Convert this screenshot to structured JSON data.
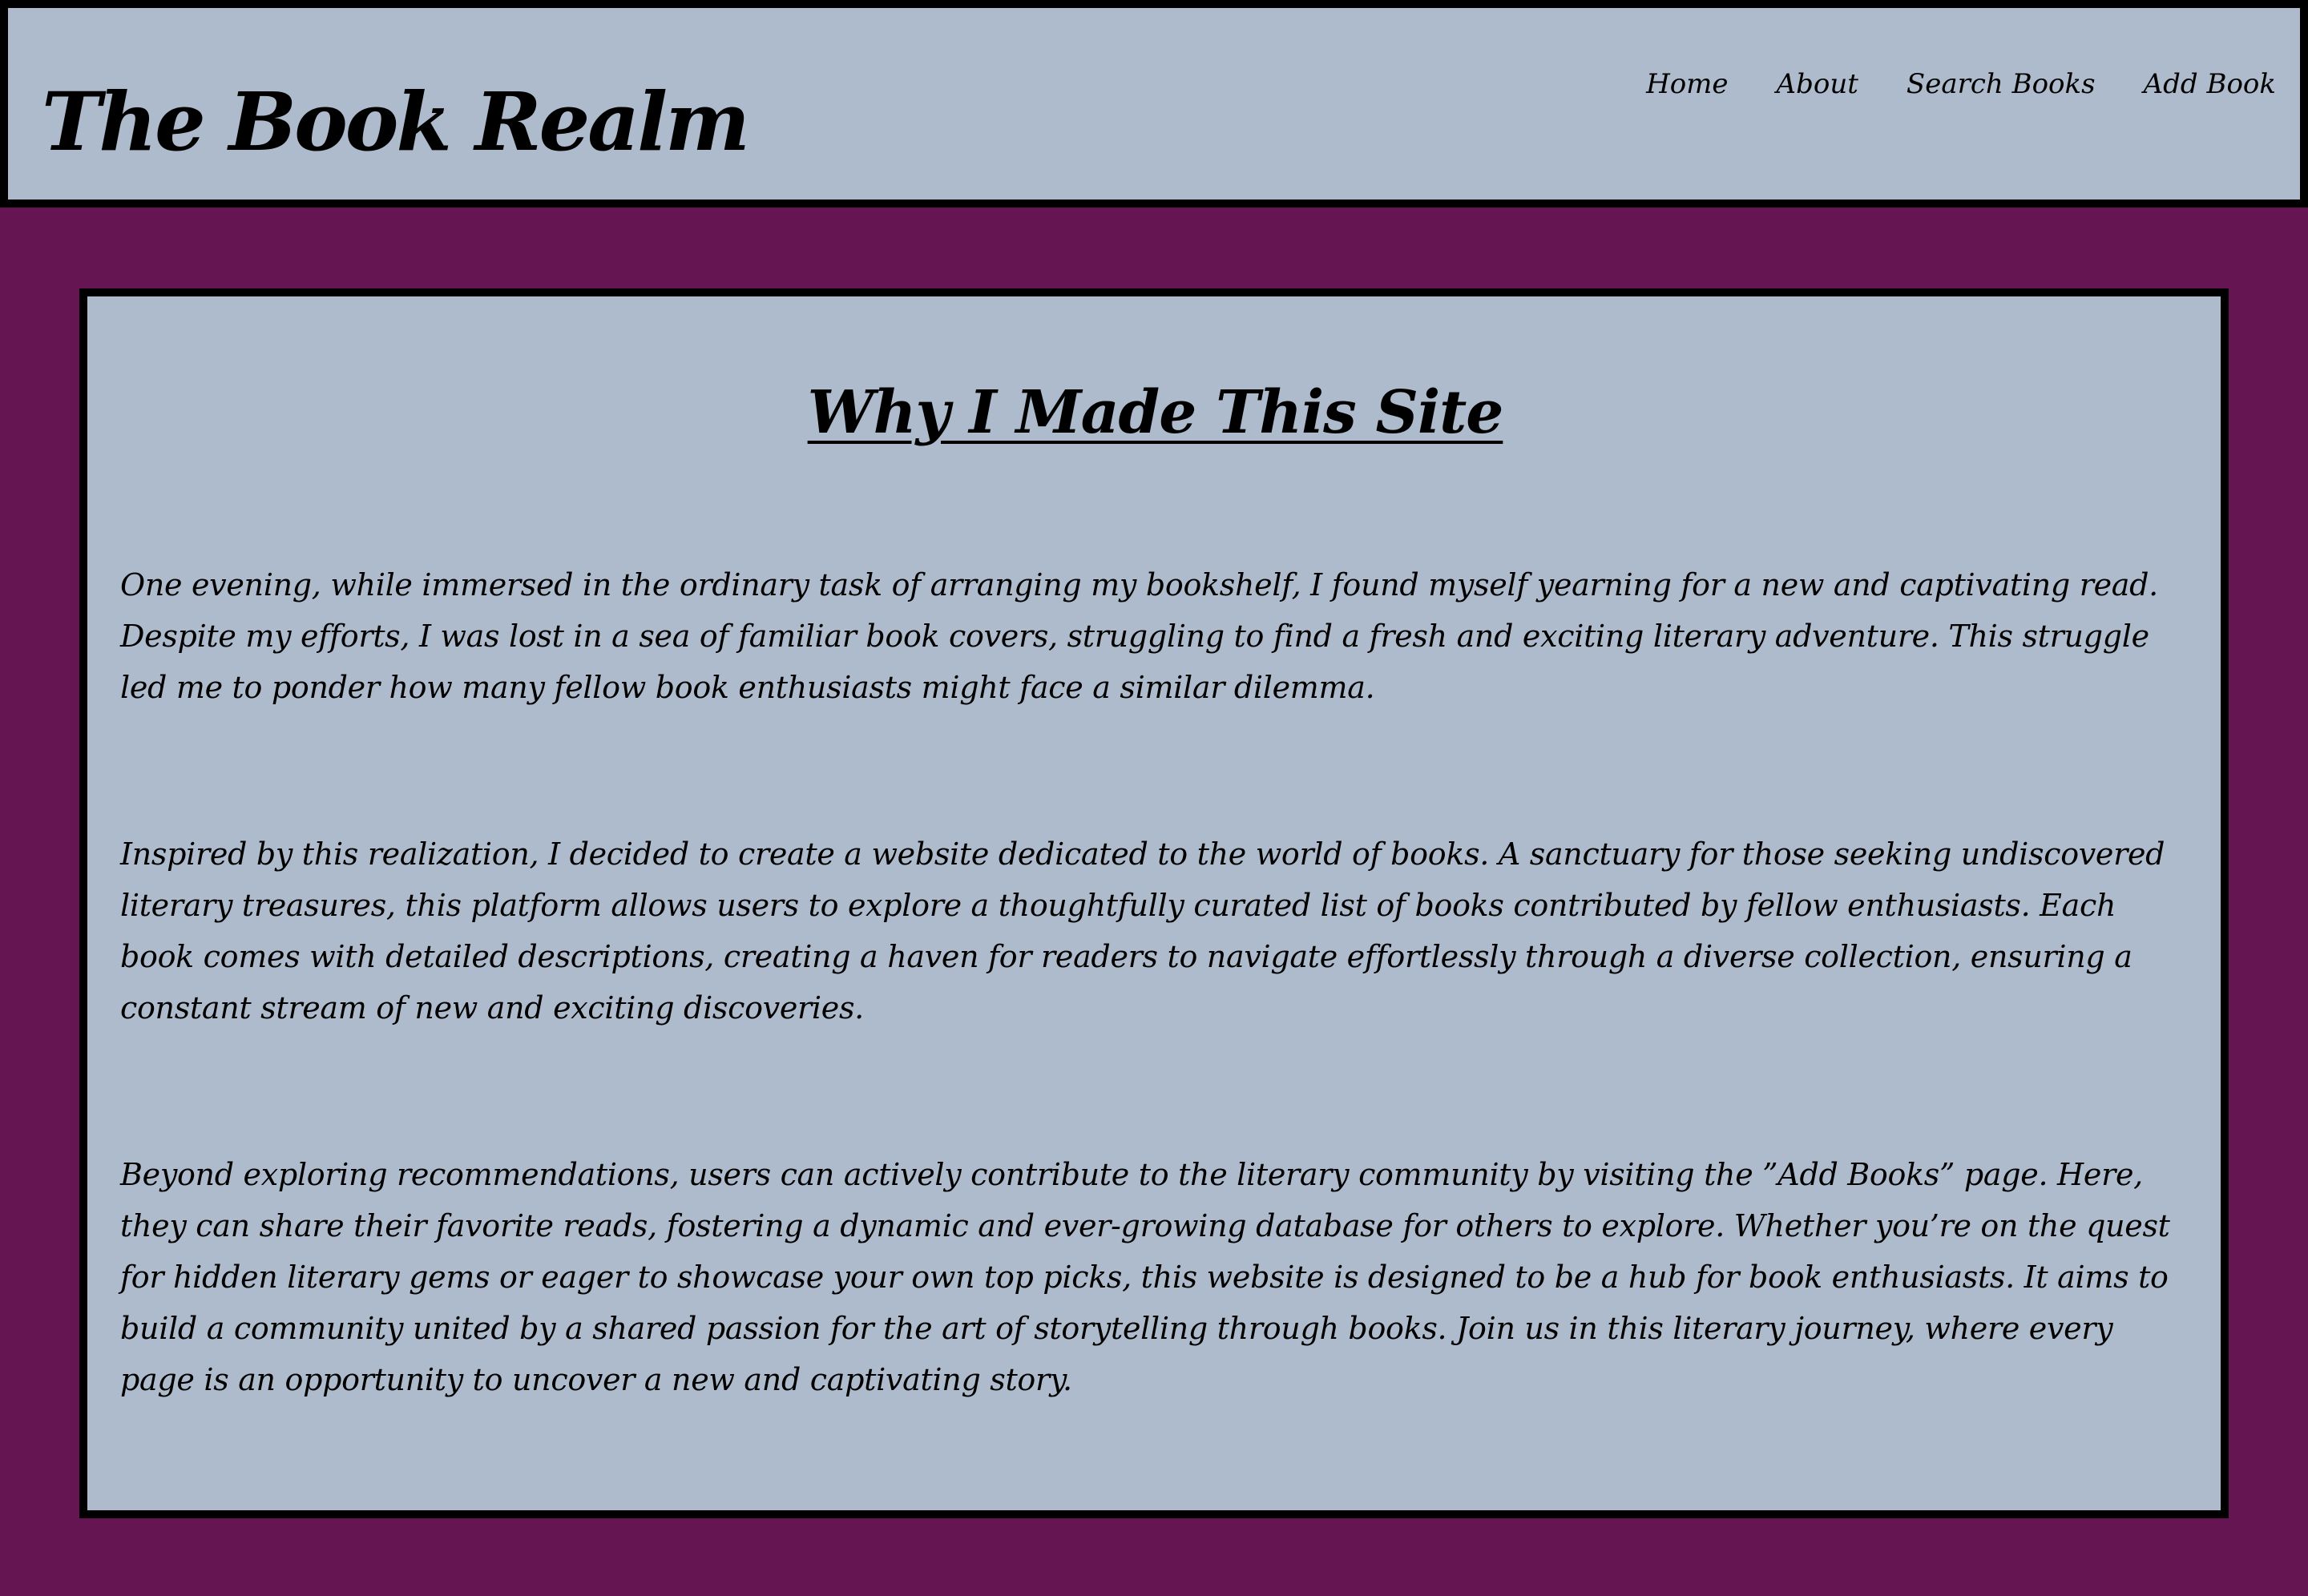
{
  "header": {
    "site_title": "The Book Realm",
    "nav": {
      "home": "Home",
      "about": "About",
      "search_books": "Search Books",
      "add_book": "Add Book"
    }
  },
  "main": {
    "heading": "Why I Made This Site",
    "paragraphs": [
      "One evening, while immersed in the ordinary task of arranging my bookshelf, I found myself yearning for a new and captivating read. Despite my efforts, I was lost in a sea of familiar book covers, struggling to find a fresh and exciting literary adventure. This struggle led me to ponder how many fellow book enthusiasts might face a similar dilemma.",
      "Inspired by this realization, I decided to create a website dedicated to the world of books. A sanctuary for those seeking undiscovered literary treasures, this platform allows users to explore a thoughtfully curated list of books contributed by fellow enthusiasts. Each book comes with detailed descriptions, creating a haven for readers to navigate effortlessly through a diverse collection, ensuring a constant stream of new and exciting discoveries.",
      "Beyond exploring recommendations, users can actively contribute to the literary community by visiting the ”Add Books” page. Here, they can share their favorite reads, fostering a dynamic and ever-growing database for others to explore. Whether you’re on the quest for hidden literary gems or eager to showcase your own top picks, this website is designed to be a hub for book enthusiasts. It aims to build a community united by a shared passion for the art of storytelling through books. Join us in this literary journey, where every page is an opportunity to uncover a new and captivating story."
    ]
  },
  "colors": {
    "page_background": "#641552",
    "panel_background": "#aebbcc",
    "border": "#000000",
    "text": "#000000"
  }
}
